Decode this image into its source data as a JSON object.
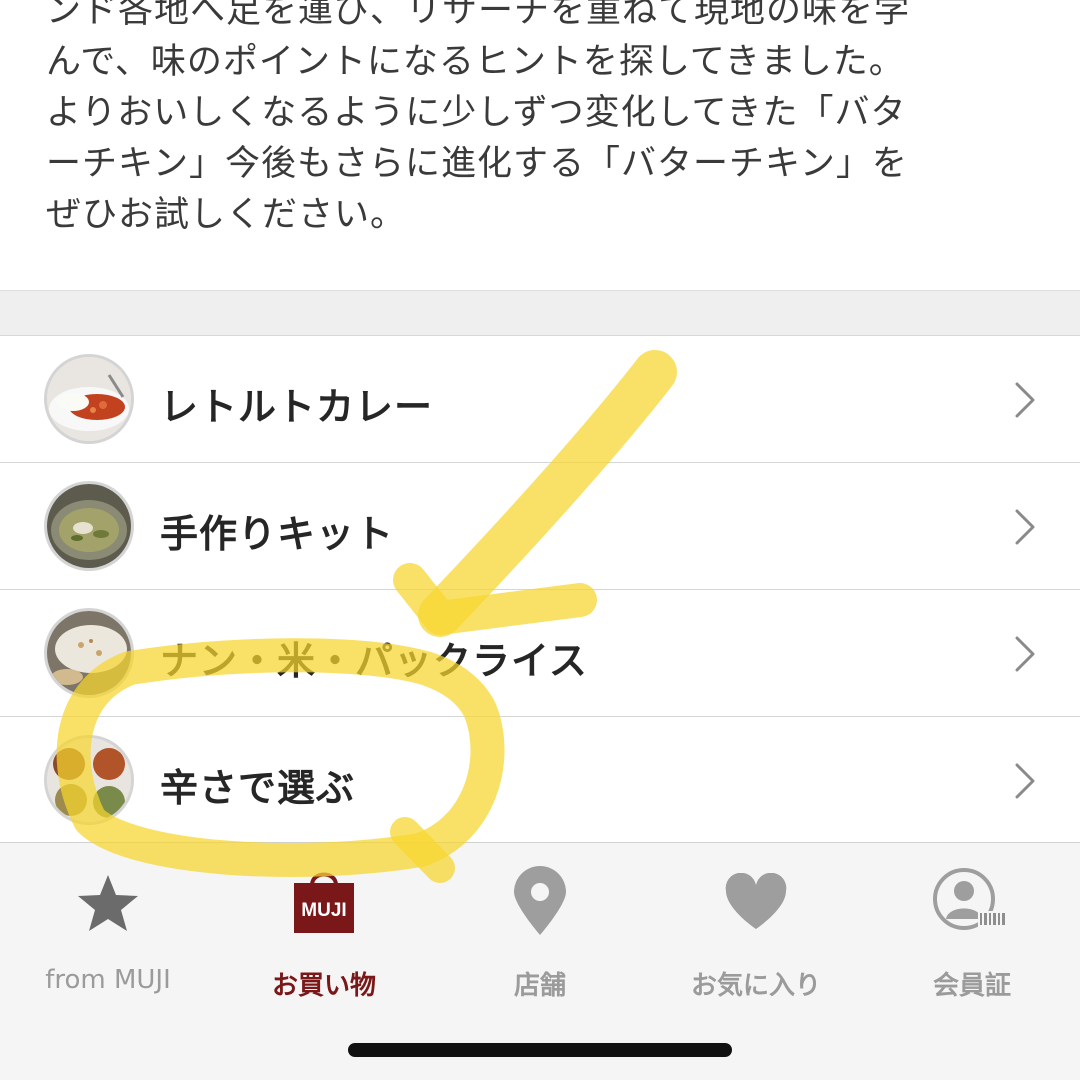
{
  "intro": {
    "lines": [
      "ンド各地へ足を運び、リサーチを重ねて現地の味を学",
      "んで、味のポイントになるヒントを探してきました。",
      "よりおいしくなるように少しずつ変化してきた「バタ",
      "ーチキン」今後もさらに進化する「バターチキン」を",
      "ぜひお試しください。"
    ]
  },
  "categories": [
    {
      "label": "レトルトカレー",
      "icon": "retort-curry-thumbnail"
    },
    {
      "label": "手作りキット",
      "icon": "handmade-kit-thumbnail"
    },
    {
      "label": "ナン・米・パックライス",
      "icon": "naan-rice-thumbnail"
    },
    {
      "label": "辛さで選ぶ",
      "icon": "spiciness-thumbnail"
    }
  ],
  "tabs": [
    {
      "label": "from MUJI",
      "icon": "star-icon",
      "active": false
    },
    {
      "label": "お買い物",
      "icon": "shopping-bag-icon",
      "badge": "MUJI",
      "active": true
    },
    {
      "label": "店舗",
      "icon": "location-pin-icon",
      "active": false
    },
    {
      "label": "お気に入り",
      "icon": "heart-icon",
      "active": false
    },
    {
      "label": "会員証",
      "icon": "member-card-icon",
      "active": false
    }
  ],
  "colors": {
    "accent": "#7a1718",
    "inactive": "#9b9b9b",
    "highlighter": "#f7d62e"
  }
}
